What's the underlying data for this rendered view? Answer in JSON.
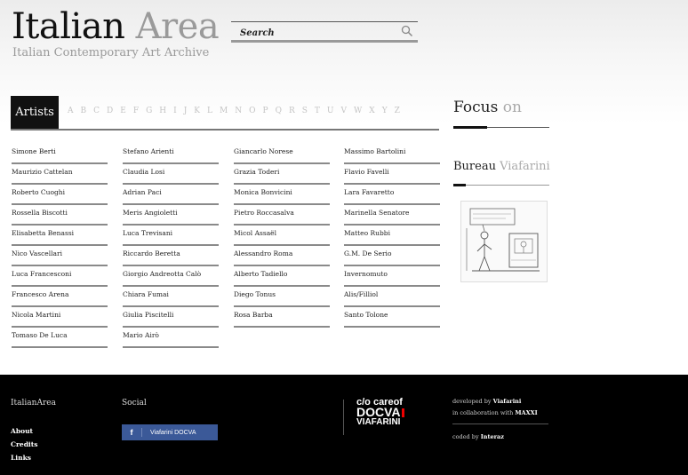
{
  "header": {
    "logo_part1": "Italian",
    "logo_part2": "Area",
    "tagline": "Italian Contemporary Art Archive",
    "search_placeholder": "Search",
    "search_icon": "search-icon"
  },
  "artists": {
    "tab_label": "Artists",
    "letters": [
      "A",
      "B",
      "C",
      "D",
      "E",
      "F",
      "G",
      "H",
      "I",
      "J",
      "K",
      "L",
      "M",
      "N",
      "O",
      "P",
      "Q",
      "R",
      "S",
      "T",
      "U",
      "V",
      "W",
      "X",
      "Y",
      "Z"
    ],
    "columns": [
      [
        "Simone Berti",
        "Maurizio Cattelan",
        "Roberto Cuoghi",
        "Rossella Biscotti",
        "Elisabetta Benassi",
        "Nico Vascellari",
        "Luca Francesconi",
        "Francesco Arena",
        "Nicola Martini",
        "Tomaso De Luca"
      ],
      [
        "Stefano Arienti",
        "Claudia Losi",
        "Adrian Paci",
        "Meris Angioletti",
        "Luca Trevisani",
        "Riccardo Beretta",
        "Giorgio Andreotta Calò",
        "Chiara Fumai",
        "Giulia Piscitelli",
        "Mario Airò"
      ],
      [
        "Giancarlo Norese",
        "Grazia Toderi",
        "Monica Bonvicini",
        "Pietro Roccasalva",
        "Micol Assaël",
        "Alessandro Roma",
        "Alberto Tadiello",
        "Diego Tonus",
        "Rosa Barba"
      ],
      [
        "Massimo Bartolini",
        "Flavio Favelli",
        "Lara Favaretto",
        "Marinella Senatore",
        "Matteo Rubbi",
        "G.M. De Serio",
        "Invernomuto",
        "Alis/Filliol",
        "Santo Tolone"
      ]
    ]
  },
  "sidebar": {
    "focus_part1": "Focus",
    "focus_part2": "on",
    "bureau_part1": "Bureau",
    "bureau_part2": "Viafarini"
  },
  "footer": {
    "site_heading": "ItalianArea",
    "links": [
      "About",
      "Credits",
      "Links"
    ],
    "social_heading": "Social",
    "facebook_label": "Viafarini DOCVA",
    "brand_line1": "c/o careof",
    "brand_line2": "DOCVA",
    "brand_line3": "VIAFARINI",
    "developed_by_text": "developed by",
    "developed_by_name": "Viafarini",
    "collab_text": "in collaboration with",
    "collab_name": "MAXXI",
    "coded_text": "coded by",
    "coded_name": "Interaz"
  }
}
